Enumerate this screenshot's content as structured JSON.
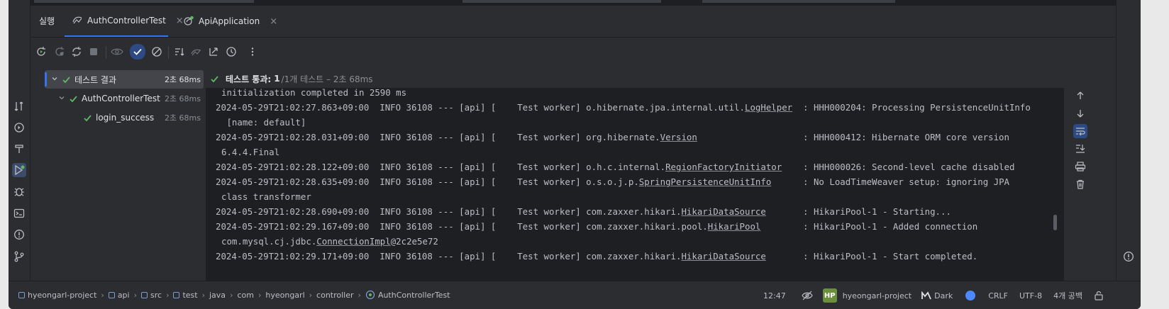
{
  "run_panel": {
    "title": "실행",
    "tabs": [
      {
        "label": "AuthControllerTest",
        "icon": "test-run-icon",
        "active": true
      },
      {
        "label": "ApiApplication",
        "icon": "spring-app-icon",
        "active": false
      }
    ],
    "close_glyph": "×"
  },
  "test_tree": {
    "items": [
      {
        "label": "테스트 결과",
        "time": "2초 68ms"
      },
      {
        "label": "AuthControllerTest",
        "time": "2초 68ms"
      },
      {
        "label": "login_success",
        "time": "2초 68ms"
      }
    ]
  },
  "status": {
    "label": "테스트 통과:",
    "count": "1",
    "detail": "/1개 테스트 – 2초 68ms"
  },
  "log_lines": [
    {
      "parts": [
        {
          "t": "initialization completed in 2590 ms"
        }
      ],
      "cont": true
    },
    {
      "parts": [
        {
          "t": "2024-05-29T21:02:27.863+09:00  INFO 36108 --- [api] [    Test worker] o.hibernate.jpa.internal.util."
        },
        {
          "t": "LogHelper",
          "u": true
        },
        {
          "t": "  : HHH000204: Processing PersistenceUnitInfo"
        }
      ]
    },
    {
      "parts": [
        {
          "t": " [name: default]"
        }
      ],
      "cont": true
    },
    {
      "parts": [
        {
          "t": "2024-05-29T21:02:28.031+09:00  INFO 36108 --- [api] [    Test worker] org.hibernate."
        },
        {
          "t": "Version",
          "u": true
        },
        {
          "t": "                    : HHH000412: Hibernate ORM core version"
        }
      ]
    },
    {
      "parts": [
        {
          "t": "6.4.4.Final"
        }
      ],
      "cont": true
    },
    {
      "parts": [
        {
          "t": "2024-05-29T21:02:28.122+09:00  INFO 36108 --- [api] [    Test worker] o.h.c.internal."
        },
        {
          "t": "RegionFactoryInitiator",
          "u": true
        },
        {
          "t": "    : HHH000026: Second-level cache disabled"
        }
      ]
    },
    {
      "parts": [
        {
          "t": "2024-05-29T21:02:28.635+09:00  INFO 36108 --- [api] [    Test worker] o.s.o.j.p."
        },
        {
          "t": "SpringPersistenceUnitInfo",
          "u": true
        },
        {
          "t": "      : No LoadTimeWeaver setup: ignoring JPA"
        }
      ]
    },
    {
      "parts": [
        {
          "t": "class transformer"
        }
      ],
      "cont": true
    },
    {
      "parts": [
        {
          "t": "2024-05-29T21:02:28.690+09:00  INFO 36108 --- [api] [    Test worker] com.zaxxer.hikari."
        },
        {
          "t": "HikariDataSource",
          "u": true
        },
        {
          "t": "       : HikariPool-1 - Starting..."
        }
      ]
    },
    {
      "parts": [
        {
          "t": "2024-05-29T21:02:29.167+09:00  INFO 36108 --- [api] [    Test worker] com.zaxxer.hikari.pool."
        },
        {
          "t": "HikariPool",
          "u": true
        },
        {
          "t": "        : HikariPool-1 - Added connection"
        }
      ]
    },
    {
      "parts": [
        {
          "t": "com.mysql.cj.jdbc."
        },
        {
          "t": "ConnectionImpl",
          "u": true
        },
        {
          "t": "@2c2e5e72"
        }
      ],
      "cont": true
    },
    {
      "parts": [
        {
          "t": "2024-05-29T21:02:29.171+09:00  INFO 36108 --- [api] [    Test worker] com.zaxxer.hikari."
        },
        {
          "t": "HikariDataSource",
          "u": true
        },
        {
          "t": "       : HikariPool-1 - Start completed."
        }
      ]
    }
  ],
  "breadcrumbs": [
    "hyeongarl-project",
    "api",
    "src",
    "test",
    "java",
    "com",
    "hyeongarl",
    "controller",
    "AuthControllerTest"
  ],
  "statusbar": {
    "position": "12:47",
    "project_badge": "HP",
    "project": "hyeongarl-project",
    "theme": "Dark",
    "line_ending": "CRLF",
    "encoding": "UTF-8",
    "indent": "4개 공백"
  },
  "colors": {
    "accent": "#3574f0",
    "pass": "#5fb865",
    "bg": "#2b2d30",
    "console_bg": "#1e1f22"
  }
}
